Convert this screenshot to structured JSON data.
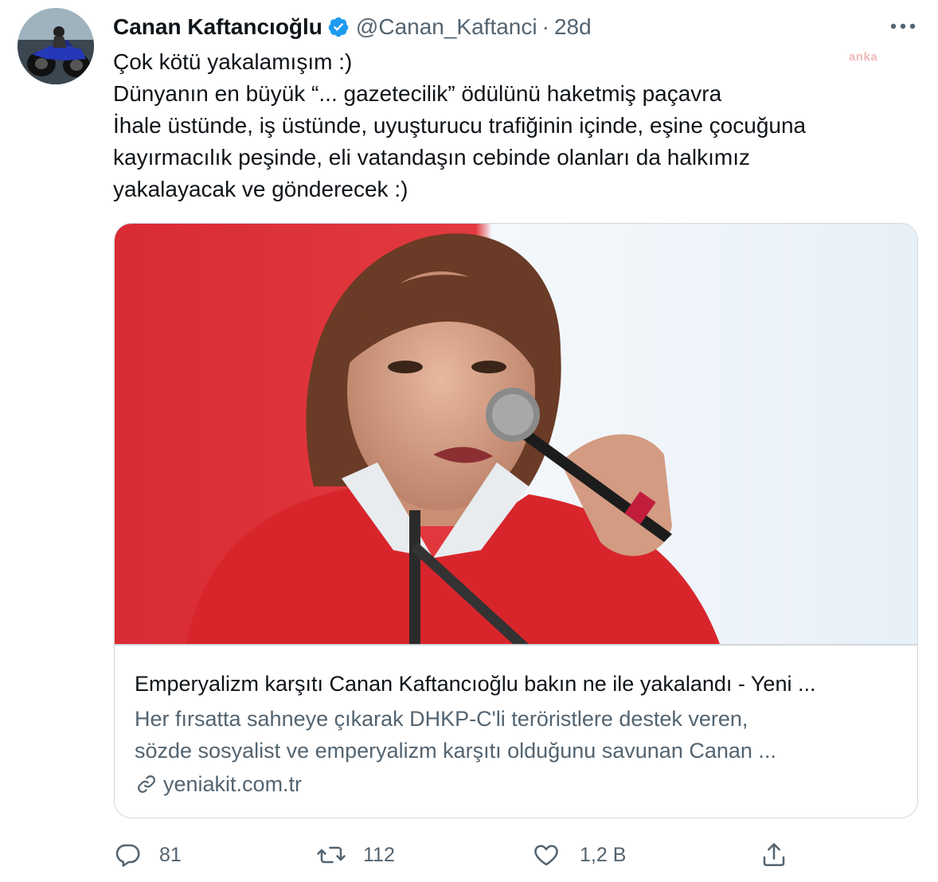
{
  "tweet": {
    "author_name": "Canan Kaftancıoğlu",
    "handle": "@Canan_Kaftanci",
    "separator": "·",
    "time": "28d",
    "watermark": "anka",
    "lines": [
      "Çok kötü yakalamışım :)",
      "Dünyanın en büyük “... gazetecilik” ödülünü haketmiş paçavra",
      "İhale üstünde, iş üstünde, uyuşturucu trafiğinin içinde, eşine çocuğuna",
      "kayırmacılık peşinde, eli vatandaşın cebinde olanları da halkımız",
      "yakalayacak ve gönderecek :)"
    ]
  },
  "card": {
    "title": "Emperyalizm karşıtı Canan Kaftancıoğlu bakın ne ile yakalandı - Yeni ...",
    "description": [
      "Her fırsatta sahneye çıkarak DHKP-C'li teröristlere destek veren,",
      "sözde sosyalist ve emperyalizm karşıtı olduğunu savunan Canan ..."
    ],
    "domain": "yeniakit.com.tr"
  },
  "actions": {
    "replies": "81",
    "retweets": "112",
    "likes": "1,2 B"
  },
  "icons": {
    "verified": "verified-badge-icon",
    "more": "more-options-icon",
    "link": "link-icon",
    "reply": "reply-icon",
    "retweet": "retweet-icon",
    "like": "heart-icon",
    "share": "share-icon"
  },
  "colors": {
    "accent": "#1d9bf0",
    "text": "#0f1419",
    "secondary": "#536471",
    "border": "#cfd9de"
  }
}
